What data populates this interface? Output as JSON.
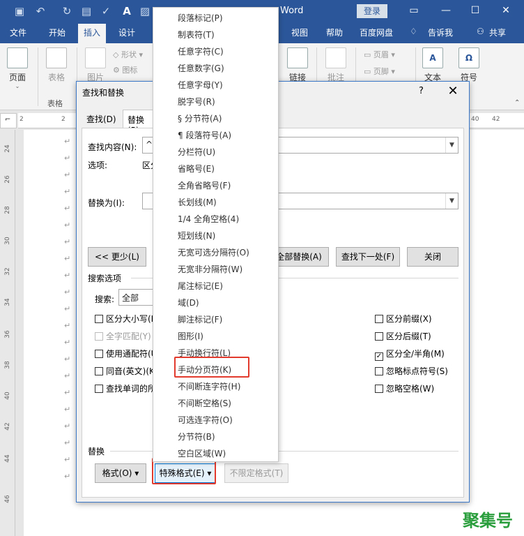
{
  "titlebar": {
    "title": "Word",
    "login": "登录",
    "window_controls": [
      "—",
      "☐",
      "✕"
    ]
  },
  "ribbon_tabs": [
    "文件",
    "开始",
    "插入",
    "设计",
    "视图",
    "帮助",
    "百度网盘",
    "告诉我",
    "共享"
  ],
  "ribbon": {
    "page": "页面",
    "table": "表格",
    "table_group": "表格",
    "picture": "图片",
    "shape": "形状",
    "icon": "图标",
    "link": "链接",
    "comment": "批注",
    "header": "页眉",
    "footer": "页脚",
    "text": "文本",
    "symbol": "符号"
  },
  "ruler": {
    "h": [
      "2",
      "2",
      "40",
      "42"
    ],
    "v": [
      "24",
      "26",
      "28",
      "30",
      "32",
      "34",
      "36",
      "38",
      "40",
      "42",
      "44",
      "46"
    ]
  },
  "dialog": {
    "title": "查找和替换",
    "help": "?",
    "close": "✕",
    "tabs": [
      "查找(D)",
      "替换(P)"
    ],
    "find_label": "查找内容(N):",
    "find_value": "^m",
    "options_label": "选项:",
    "options_value": "区分全/半角",
    "replace_label": "替换为(I):",
    "replace_value": "",
    "btn_less": "<< 更少(L)",
    "btn_replace_all": "全部替换(A)",
    "btn_find_next": "查找下一处(F)",
    "btn_close": "关闭",
    "search_options": "搜索选项",
    "search_label": "搜索:",
    "search_value": "全部",
    "left_checks": [
      {
        "label": "区分大小写(H)",
        "checked": false,
        "dim": false
      },
      {
        "label": "全字匹配(Y)",
        "checked": false,
        "dim": true
      },
      {
        "label": "使用通配符(U)",
        "checked": false,
        "dim": false
      },
      {
        "label": "同音(英文)(K)",
        "checked": false,
        "dim": false
      },
      {
        "label": "查找单词的所有形式(英文)(W)",
        "checked": false,
        "dim": false
      }
    ],
    "right_checks": [
      {
        "label": "区分前缀(X)",
        "checked": false
      },
      {
        "label": "区分后缀(T)",
        "checked": false
      },
      {
        "label": "区分全/半角(M)",
        "checked": true
      },
      {
        "label": "忽略标点符号(S)",
        "checked": false
      },
      {
        "label": "忽略空格(W)",
        "checked": false
      }
    ],
    "replace_section": "替换",
    "btn_format": "格式(O) ▾",
    "btn_special": "特殊格式(E) ▾",
    "btn_no_format": "不限定格式(T)"
  },
  "special_menu": [
    {
      "label": "段落标记(P)",
      "dim": false
    },
    {
      "label": "制表符(T)",
      "dim": false
    },
    {
      "label": "任意字符(C)",
      "dim": false
    },
    {
      "label": "任意数字(G)",
      "dim": false
    },
    {
      "label": "任意字母(Y)",
      "dim": false
    },
    {
      "label": "脱字号(R)",
      "dim": false
    },
    {
      "label": "§ 分节符(A)",
      "dim": false
    },
    {
      "label": "¶ 段落符号(A)",
      "dim": false
    },
    {
      "label": "分栏符(U)",
      "dim": false
    },
    {
      "label": "省略号(E)",
      "dim": false
    },
    {
      "label": "全角省略号(F)",
      "dim": false
    },
    {
      "label": "长划线(M)",
      "dim": false
    },
    {
      "label": "1/4 全角空格(4)",
      "dim": false
    },
    {
      "label": "短划线(N)",
      "dim": false
    },
    {
      "label": "无宽可选分隔符(O)",
      "dim": false
    },
    {
      "label": "无宽非分隔符(W)",
      "dim": false
    },
    {
      "label": "尾注标记(E)",
      "dim": false
    },
    {
      "label": "域(D)",
      "dim": false
    },
    {
      "label": "脚注标记(F)",
      "dim": false
    },
    {
      "label": "图形(I)",
      "dim": false
    },
    {
      "label": "手动换行符(L)",
      "dim": false
    },
    {
      "label": "手动分页符(K)",
      "dim": false
    },
    {
      "label": "不间断连字符(H)",
      "dim": false
    },
    {
      "label": "不间断空格(S)",
      "dim": false
    },
    {
      "label": "可选连字符(O)",
      "dim": false
    },
    {
      "label": "分节符(B)",
      "dim": false
    },
    {
      "label": "空白区域(W)",
      "dim": false
    }
  ],
  "para_mark": "↵",
  "watermark": "聚集号",
  "colors": {
    "accent": "#2b579a",
    "highlight": "#e23b2e"
  }
}
